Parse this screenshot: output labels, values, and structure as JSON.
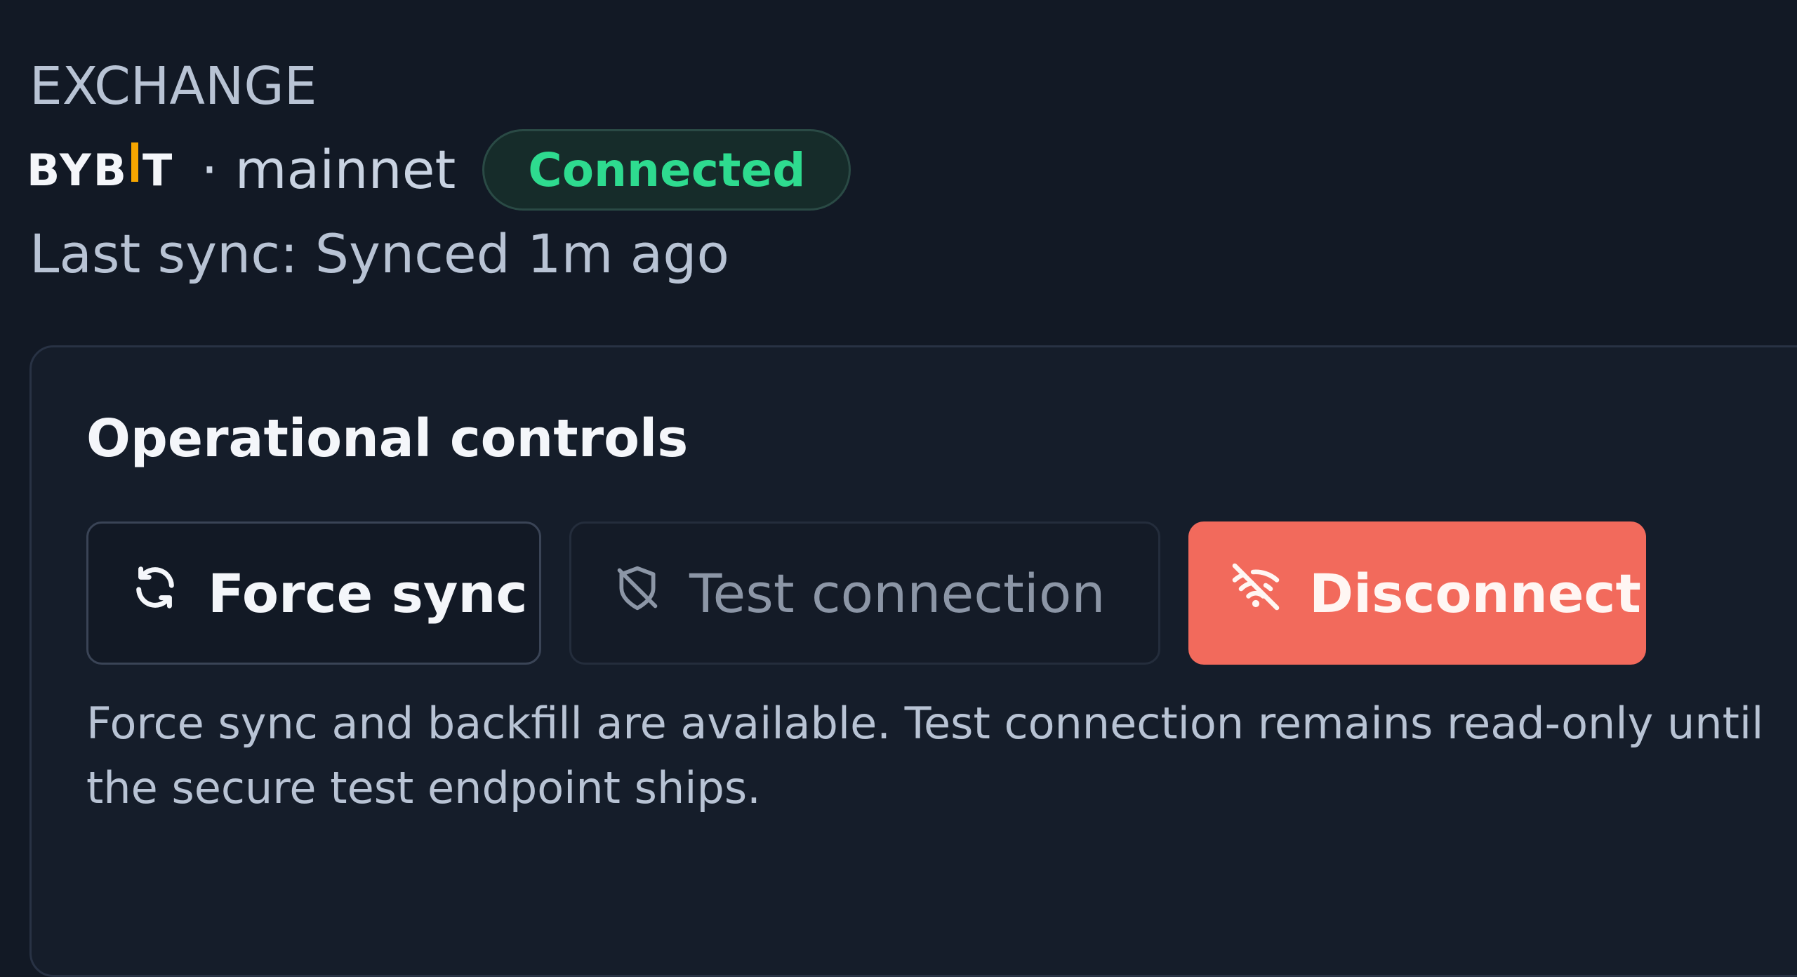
{
  "header": {
    "section_label": "EXCHANGE",
    "brand": {
      "name": "BYBIT",
      "part_before_bar": "BYB",
      "part_after_bar": "T",
      "accent_color": "#f7a600"
    },
    "network": "· mainnet",
    "status": {
      "label": "Connected",
      "color": "#2edb8f"
    },
    "last_sync": "Last sync: Synced 1m ago"
  },
  "operational_controls": {
    "title": "Operational controls",
    "buttons": [
      {
        "label": "Force sync",
        "icon": "refresh-icon",
        "state": "enabled"
      },
      {
        "label": "Test connection",
        "icon": "shield-off-icon",
        "state": "disabled"
      },
      {
        "label": "Disconnect",
        "icon": "wifi-off-icon",
        "state": "danger",
        "color": "#f26a5c"
      }
    ],
    "hint": "Force sync and backfill are available. Test connection remains read-only until the secure test endpoint ships."
  }
}
